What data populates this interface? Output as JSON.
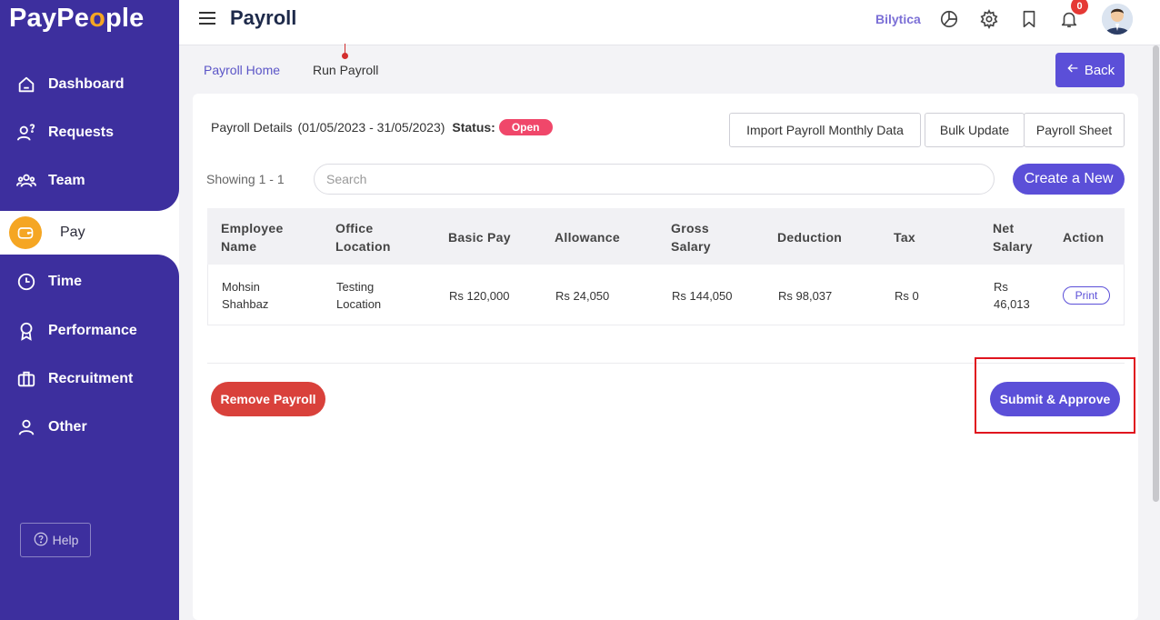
{
  "app": {
    "logo_text_1": "PayPe",
    "logo_text_o": "o",
    "logo_text_2": "ple"
  },
  "sidebar": {
    "items": [
      {
        "label": "Dashboard",
        "icon": "home-icon"
      },
      {
        "label": "Requests",
        "icon": "person-question-icon"
      },
      {
        "label": "Team",
        "icon": "team-icon"
      },
      {
        "label": "Pay",
        "icon": "wallet-icon",
        "active": true
      },
      {
        "label": "Time",
        "icon": "clock-icon"
      },
      {
        "label": "Performance",
        "icon": "award-icon"
      },
      {
        "label": "Recruitment",
        "icon": "briefcase-icon"
      },
      {
        "label": "Other",
        "icon": "user-icon"
      }
    ],
    "help_label": "Help"
  },
  "header": {
    "title": "Payroll",
    "company": "Bilytica",
    "notification_count": "0"
  },
  "breadcrumb": {
    "home": "Payroll Home",
    "current": "Run Payroll"
  },
  "back_label": "Back",
  "details": {
    "label": "Payroll Details",
    "period": "(01/05/2023 - 31/05/2023)",
    "status_label": "Status:",
    "status_value": "Open"
  },
  "actions": {
    "import": "Import Payroll Monthly Data",
    "bulk": "Bulk Update",
    "sheet": "Payroll Sheet",
    "create": "Create a New",
    "remove": "Remove Payroll",
    "approve": "Submit & Approve"
  },
  "list": {
    "showing": "Showing 1 - 1",
    "search_placeholder": "Search"
  },
  "table": {
    "headers": [
      [
        "Employee",
        "Name"
      ],
      [
        "Office",
        "Location"
      ],
      [
        "Basic Pay"
      ],
      [
        "Allowance"
      ],
      [
        "Gross",
        "Salary"
      ],
      [
        "Deduction"
      ],
      [
        "Tax"
      ],
      [
        "Net",
        "Salary"
      ],
      [
        "Action"
      ]
    ],
    "rows": [
      {
        "employee": [
          "Mohsin",
          "Shahbaz"
        ],
        "location": [
          "Testing",
          "Location"
        ],
        "basic_pay": "Rs 120,000",
        "allowance": "Rs 24,050",
        "gross": "Rs 144,050",
        "deduction": "Rs 98,037",
        "tax": "Rs 0",
        "net": [
          "Rs",
          "46,013"
        ],
        "action": "Print"
      }
    ]
  },
  "colors": {
    "brand": "#3d2f9e",
    "accent": "#5b4fd8",
    "danger": "#d9413b",
    "status_open": "#f0476a",
    "highlight": "#e0141e"
  }
}
